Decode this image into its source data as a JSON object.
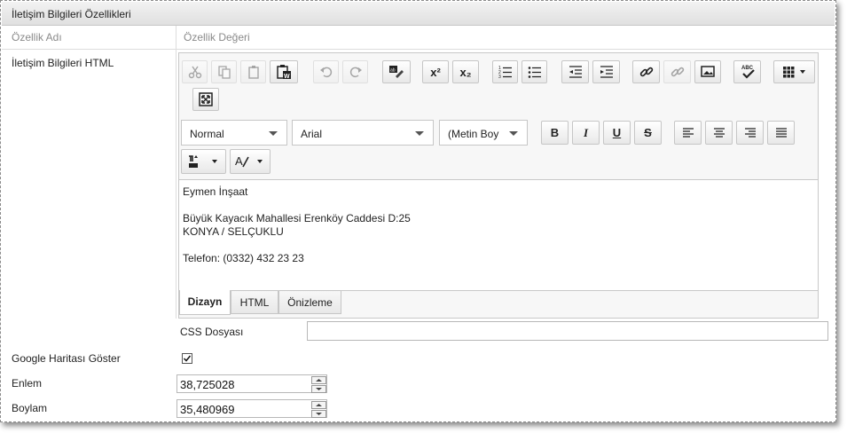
{
  "header": {
    "title": "İletişim Bilgileri Özellikleri"
  },
  "columns": {
    "name": "Özellik Adı",
    "value": "Özellik Değeri"
  },
  "rows": {
    "html_label": "İletişim Bilgileri HTML",
    "map_label": "Google Haritası Göster",
    "lat_label": "Enlem",
    "lon_label": "Boylam"
  },
  "toolbar": {
    "format": "Normal",
    "font": "Arial",
    "size": "(Metin Boy",
    "bold": "B",
    "italic": "I",
    "underline": "U",
    "strike": "S",
    "superscript": "x²",
    "subscript": "x₂",
    "spellcheck": "ABC"
  },
  "editor": {
    "lines": [
      "Eymen İnşaat",
      "Büyük Kayacık Mahallesi Erenköy Caddesi D:25",
      "KONYA  /  SELÇUKLU",
      "Telefon: (0332) 432 23 23"
    ]
  },
  "tabs": [
    "Dizayn",
    "HTML",
    "Önizleme"
  ],
  "css_field": {
    "label": "CSS Dosyası",
    "value": ""
  },
  "map_checked": true,
  "latitude": "38,725028",
  "longitude": "35,480969"
}
